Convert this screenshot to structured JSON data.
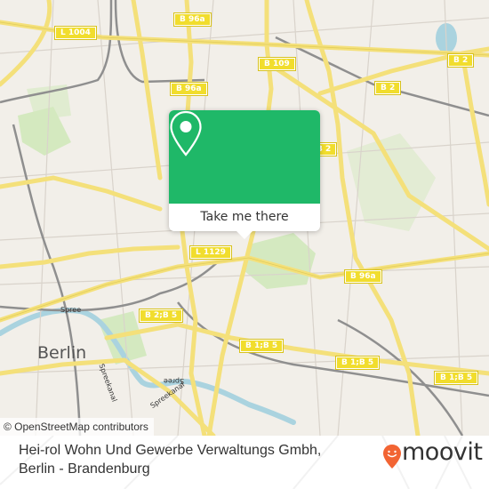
{
  "map": {
    "road_labels": [
      "L 1004",
      "B 96a",
      "B 96a",
      "B 109",
      "B 2",
      "B 2",
      "B 2",
      "L 1129",
      "B 96a",
      "B 2;B 5",
      "B 1;B 5",
      "B 1;B 5",
      "B 1;B 5"
    ],
    "place_labels": {
      "city": "Berlin",
      "river_1": "Spree",
      "river_2": "Spree",
      "canal_1": "Spreekanal",
      "canal_2": "Spreekanal"
    },
    "attribution": "© OpenStreetMap contributors"
  },
  "popup": {
    "icon": "map-pin-icon",
    "button_label": "Take me there",
    "accent_color": "#1fb868"
  },
  "footer": {
    "title_line1": "Hei-rol Wohn Und Gewerbe Verwaltungs Gmbh,",
    "title_line2": "Berlin - Brandenburg",
    "brand": "moovit",
    "brand_color": "#f26433"
  }
}
